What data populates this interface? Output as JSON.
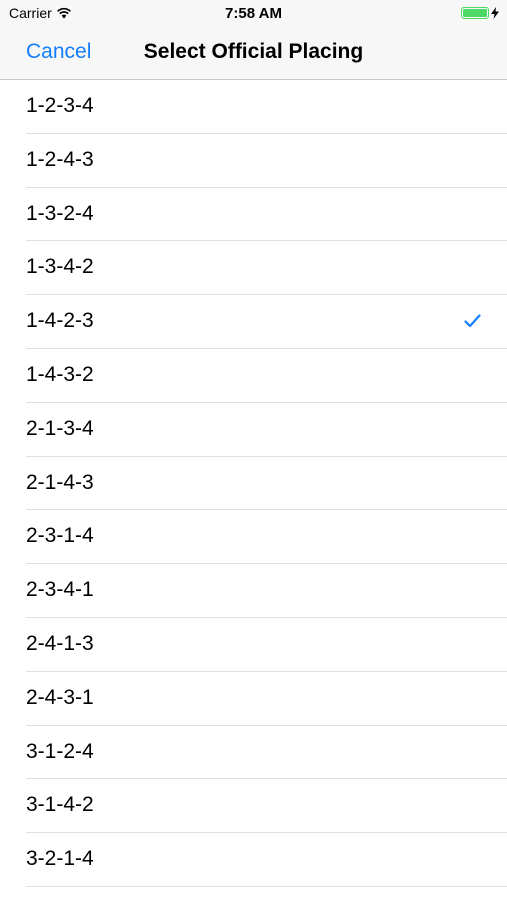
{
  "status_bar": {
    "carrier": "Carrier",
    "time": "7:58 AM",
    "battery_level": 1.0,
    "icons": [
      "wifi-icon",
      "battery-icon",
      "charging-bolt-icon"
    ]
  },
  "nav": {
    "cancel_label": "Cancel",
    "title": "Select Official Placing"
  },
  "colors": {
    "accent": "#157efb",
    "battery": "#4cd964",
    "separator": "#e0e0e3"
  },
  "options": [
    {
      "label": "1-2-3-4",
      "selected": false
    },
    {
      "label": "1-2-4-3",
      "selected": false
    },
    {
      "label": "1-3-2-4",
      "selected": false
    },
    {
      "label": "1-3-4-2",
      "selected": false
    },
    {
      "label": "1-4-2-3",
      "selected": true
    },
    {
      "label": "1-4-3-2",
      "selected": false
    },
    {
      "label": "2-1-3-4",
      "selected": false
    },
    {
      "label": "2-1-4-3",
      "selected": false
    },
    {
      "label": "2-3-1-4",
      "selected": false
    },
    {
      "label": "2-3-4-1",
      "selected": false
    },
    {
      "label": "2-4-1-3",
      "selected": false
    },
    {
      "label": "2-4-3-1",
      "selected": false
    },
    {
      "label": "3-1-2-4",
      "selected": false
    },
    {
      "label": "3-1-4-2",
      "selected": false
    },
    {
      "label": "3-2-1-4",
      "selected": false
    }
  ]
}
